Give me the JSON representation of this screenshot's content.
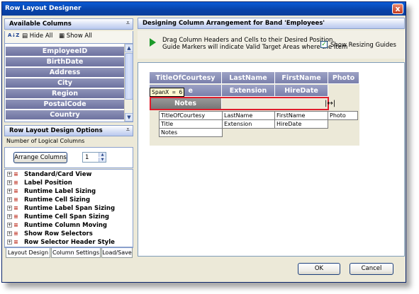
{
  "window": {
    "title": "Row Layout Designer",
    "close_glyph": "x"
  },
  "available_columns": {
    "title": "Available Columns",
    "pin_glyph": "⩡",
    "toolbar": {
      "sort_glyph": "A↓Z",
      "hide_all": "Hide All",
      "show_all": "Show All"
    },
    "items": [
      "EmployeeID",
      "BirthDate",
      "Address",
      "City",
      "Region",
      "PostalCode",
      "Country"
    ]
  },
  "options_panel": {
    "title": "Row Layout Design Options",
    "pin_glyph": "⩡",
    "logical_columns_label": "Number of Logical Columns",
    "arrange_button": "Arrange Columns",
    "logical_columns_value": "1",
    "tree_items": [
      "Standard/Card View",
      "Label Position",
      "Runtime Label Sizing",
      "Runtime Cell Sizing",
      "Runtime Label Span Sizing",
      "Runtime Cell Span Sizing",
      "Runtime Column Moving",
      "Show Row Selectors",
      "Row Selector Header Style"
    ]
  },
  "tabs": [
    "Layout Design",
    "Column Settings",
    "Load/Save"
  ],
  "designer": {
    "title": "Designing Column Arrangement for Band 'Employees'",
    "hint_line1": "Drag Column Headers and Cells to their Desired Position.",
    "hint_line2": "Guide Markers will indicate Valid Target Areas where the Item",
    "show_guides_label": "Show Resizing Guides",
    "show_guides_checked": true,
    "headers_row1": [
      "TitleOfCourtesy",
      "LastName",
      "FirstName",
      "Photo"
    ],
    "headers_row2_partial": "e",
    "headers_row2": [
      "Extension",
      "HireDate"
    ],
    "notes_header": "Notes",
    "spanx_tip": "SpanX = 6",
    "cells_row1": [
      "TitleOfCourtesy",
      "LastName",
      "FirstName",
      "Photo"
    ],
    "cells_row2": [
      "Title",
      "Extension",
      "HireDate"
    ],
    "cells_row3": [
      "Notes"
    ]
  },
  "buttons": {
    "ok": "OK",
    "cancel": "Cancel"
  },
  "colors": {
    "field_header": "#7a80ab",
    "marker": "#e01c2b",
    "titlebar": "#0a5bd6"
  }
}
